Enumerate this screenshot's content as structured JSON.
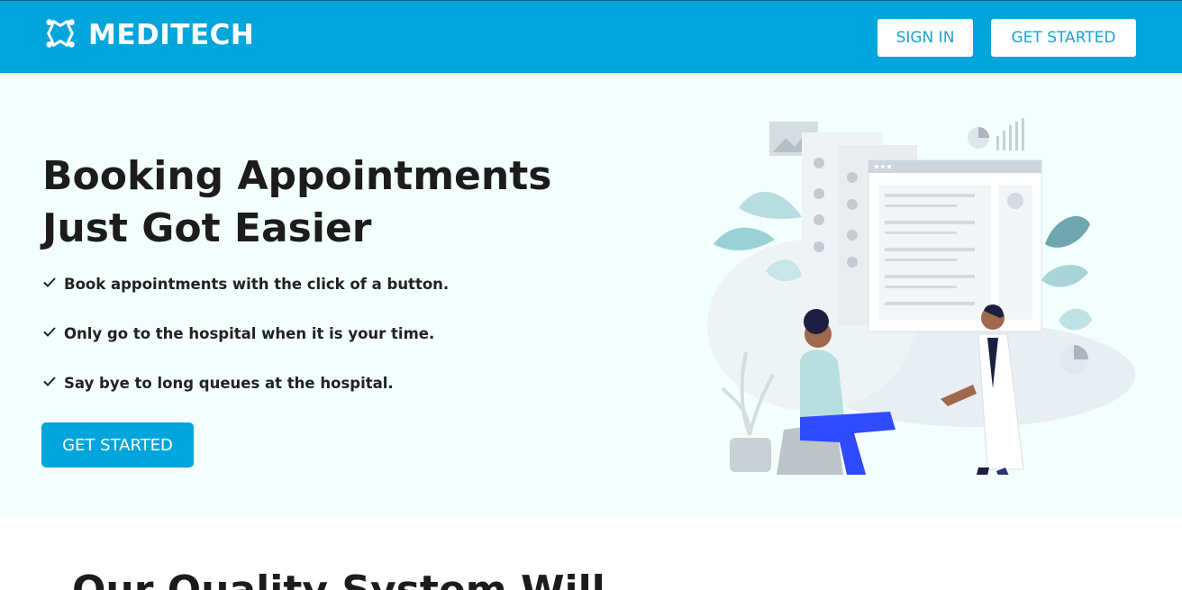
{
  "navbar": {
    "brand": "MEDITECH",
    "logo_icon": "logo-icon",
    "sign_in_label": "SIGN IN",
    "get_started_label": "GET STARTED",
    "background": "#00a6db"
  },
  "hero": {
    "title_line1": "Booking Appointments",
    "title_line2": "Just Got Easier",
    "features": [
      "Book appointments with the click of a button.",
      "Only go to the hospital when it is your time.",
      "Say bye to long queues at the hospital."
    ],
    "feature_icon": "check-icon",
    "cta_label": "GET STARTED",
    "background": "#f2fffd"
  },
  "section": {
    "heading": "Our Quality System Will"
  },
  "colors": {
    "accent": "#00a6db",
    "white": "#ffffff",
    "text": "#1c1c1c"
  }
}
